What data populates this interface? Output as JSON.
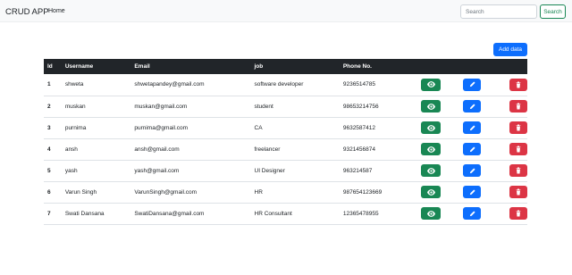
{
  "navbar": {
    "brand": "CRUD APP",
    "home": "Home",
    "search_placeholder": "Search",
    "search_button": "Search"
  },
  "add_button": "Add data",
  "table": {
    "columns": [
      "Id",
      "Username",
      "Email",
      "job",
      "Phone No."
    ],
    "rows": [
      {
        "id": "1",
        "username": "shweta",
        "email": "shwetapandey@gmail.com",
        "job": "software developer",
        "phone": "9236514785"
      },
      {
        "id": "2",
        "username": "muskan",
        "email": "muskan@gmail.com",
        "job": "student",
        "phone": "98653214756"
      },
      {
        "id": "3",
        "username": "purnima",
        "email": "purnima@gmail.com",
        "job": "CA",
        "phone": "9632587412"
      },
      {
        "id": "4",
        "username": "ansh",
        "email": "ansh@gmail.com",
        "job": "freelancer",
        "phone": "9321456874"
      },
      {
        "id": "5",
        "username": "yash",
        "email": "yash@gmail.com",
        "job": "UI Designer",
        "phone": "963214587"
      },
      {
        "id": "6",
        "username": "Varun Singh",
        "email": "VarunSingh@gmail.com",
        "job": "HR",
        "phone": "987654123669"
      },
      {
        "id": "7",
        "username": "Swati Dansana",
        "email": "SwatiDansana@gmail.com",
        "job": "HR Consultant",
        "phone": "12365478955"
      }
    ],
    "actions": {
      "view_icon": "eye-icon",
      "edit_icon": "pencil-icon",
      "delete_icon": "trash-icon"
    }
  },
  "colors": {
    "navbar_bg": "#f8f9fa",
    "header_bg": "#212529",
    "view": "#198754",
    "edit": "#0d6efd",
    "delete": "#dc3545",
    "search_outline": "#198754"
  }
}
